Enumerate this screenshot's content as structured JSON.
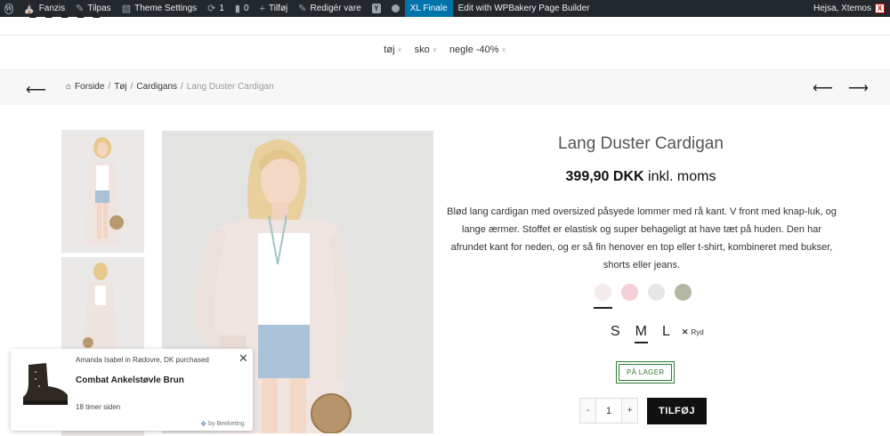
{
  "admin_bar": {
    "site_name": "Fanzis",
    "customize": "Tilpas",
    "theme_settings": "Theme Settings",
    "updates_count": "1",
    "comments_count": "0",
    "new": "Tilføj",
    "edit_product": "Redigér vare",
    "xl_finale": "XL Finale",
    "wpbakery": "Edit with WPBakery Page Builder",
    "greeting": "Hejsa, Xtemos"
  },
  "nav": {
    "items": [
      {
        "label": "tøj"
      },
      {
        "label": "sko"
      },
      {
        "label": "negle -40%"
      }
    ]
  },
  "breadcrumb": {
    "home": "Forside",
    "sep": "/",
    "level1": "Tøj",
    "level2": "Cardigans",
    "current": "Lang Duster Cardigan"
  },
  "product": {
    "title": "Lang Duster Cardigan",
    "price": "399,90 DKK",
    "price_suffix": "inkl. moms",
    "description": "Blød lang cardigan med oversized påsyede lommer med rå kant. V front med knap-luk, og lange ærmer. Stoffet er elastisk og super behageligt at have tæt på huden. Den har afrundet kant for neden, og er så fin henover en top eller t-shirt, kombineret med bukser, shorts eller jeans.",
    "colors": [
      "#f3ecea",
      "#f3cfd6",
      "#e6e6e6",
      "#b3b8a2"
    ],
    "sizes": [
      {
        "label": "S",
        "active": false
      },
      {
        "label": "M",
        "active": true
      },
      {
        "label": "L",
        "active": false
      }
    ],
    "clear_label": "Ryd",
    "stock": "PÅ LAGER",
    "quantity": "1",
    "qty_minus": "-",
    "qty_plus": "+",
    "add_to_cart": "TILFØJ"
  },
  "notification": {
    "who": "Amanda Isabel in Rødovre, DK purchased",
    "product_name": "Combat Ankelstøvle Brun",
    "time": "18 timer siden",
    "by": "by Beeketing"
  },
  "colors": {
    "admin_bar": "#23282d",
    "xl_active": "#0073aa",
    "stock_green": "#2e7d32",
    "button_black": "#111111"
  }
}
